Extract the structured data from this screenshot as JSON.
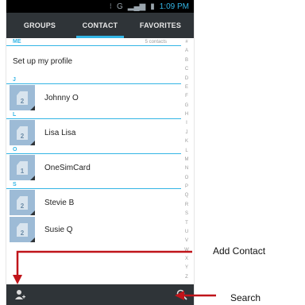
{
  "status_bar": {
    "network": "G",
    "time": "1:09 PM"
  },
  "tabs": [
    {
      "label": "GROUPS"
    },
    {
      "label": "CONTACT"
    },
    {
      "label": "FAVORITES"
    }
  ],
  "me_section": {
    "letter": "ME",
    "count": "5 contacts",
    "profile_label": "Set up my profile"
  },
  "sections": [
    {
      "letter": "J",
      "contacts": [
        {
          "name": "Johnny O",
          "sim": "2"
        }
      ]
    },
    {
      "letter": "L",
      "contacts": [
        {
          "name": "Lisa Lisa",
          "sim": "2"
        }
      ]
    },
    {
      "letter": "O",
      "contacts": [
        {
          "name": "OneSimCard",
          "sim": "1"
        }
      ]
    },
    {
      "letter": "S",
      "contacts": [
        {
          "name": "Stevie B",
          "sim": "2"
        },
        {
          "name": "Susie Q",
          "sim": "2"
        }
      ]
    }
  ],
  "alphabet": [
    "#",
    "A",
    "B",
    "C",
    "D",
    "E",
    "F",
    "G",
    "H",
    "I",
    "J",
    "K",
    "L",
    "M",
    "N",
    "O",
    "P",
    "Q",
    "R",
    "S",
    "T",
    "U",
    "V",
    "W",
    "X",
    "Y",
    "Z"
  ],
  "bottom_bar": {
    "left_icon": "add-contact-icon",
    "right_icon": "search-icon"
  },
  "annotations": {
    "add_contact": "Add Contact",
    "search": "Search",
    "arrow_color": "#c0141a"
  },
  "colors": {
    "accent": "#33b5e5",
    "bar": "#2f3438",
    "avatar": "#9dbbd6"
  }
}
